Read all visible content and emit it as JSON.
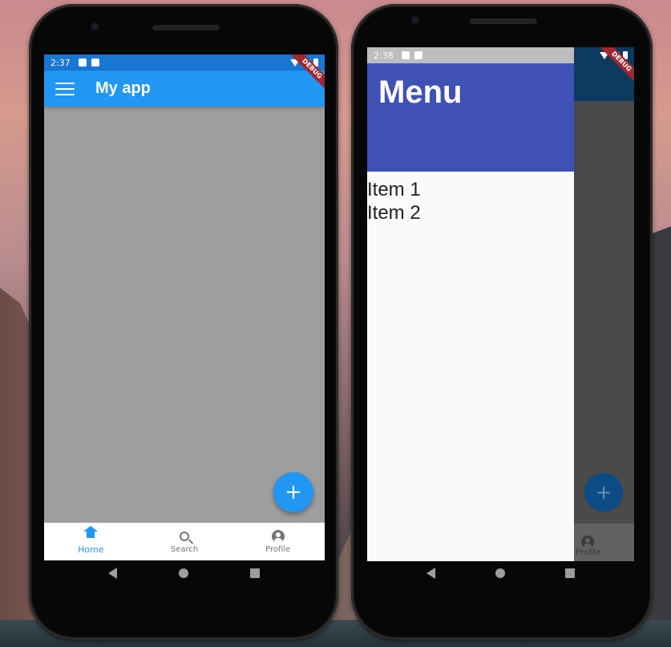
{
  "left_phone": {
    "status_bar": {
      "time": "2:37"
    },
    "app_bar": {
      "title": "My app",
      "leading_icon": "menu-icon"
    },
    "fab": {
      "icon": "plus-icon",
      "label": "+"
    },
    "bottom_nav": {
      "items": [
        {
          "label": "Home",
          "icon": "home-icon",
          "active": true
        },
        {
          "label": "Search",
          "icon": "search-icon",
          "active": false
        },
        {
          "label": "Profile",
          "icon": "account-circle-icon",
          "active": false
        }
      ]
    },
    "debug_banner": "DEBUG"
  },
  "right_phone": {
    "status_bar": {
      "time": "2:38"
    },
    "drawer": {
      "header_title": "Menu",
      "items": [
        {
          "label": "Item 1"
        },
        {
          "label": "Item 2"
        }
      ]
    },
    "fab": {
      "label": "+"
    },
    "bottom_nav": {
      "visible_item": {
        "label": "Profile",
        "icon": "account-circle-icon"
      }
    },
    "debug_banner": "DEBUG"
  },
  "colors": {
    "primary": "#2196f3",
    "status_bar": "#1976d2",
    "drawer_header": "#3f51b5",
    "body_background": "#9e9e9e"
  }
}
